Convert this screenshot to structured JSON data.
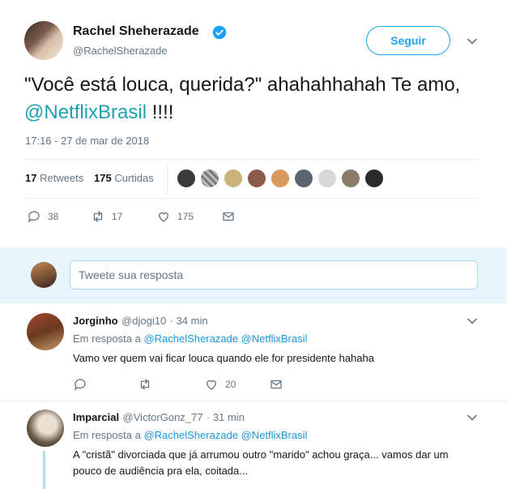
{
  "tweet": {
    "author_name": "Rachel Sheherazade",
    "author_handle": "@RachelSherazade",
    "follow_label": "Seguir",
    "text_before": "\"Você está louca, querida?\" ahahahhahah Te amo, ",
    "mention": "@NetflixBrasil",
    "text_after": " !!!!",
    "timestamp": "17:16 - 27 de mar de 2018",
    "retweets_count": "17",
    "retweets_label": "Retweets",
    "likes_count": "175",
    "likes_label": "Curtidas",
    "actions": {
      "replies": "38",
      "retweets": "17",
      "likes": "175"
    }
  },
  "reply_box": {
    "placeholder": "Tweete sua resposta"
  },
  "replies": [
    {
      "name": "Jorginho",
      "handle": "@djogi10",
      "time": "· 34 min",
      "in_reply_label": "Em resposta a",
      "in_reply_mentions": "@RachelSherazade @NetflixBrasil",
      "text": "Vamo ver quem vai ficar louca quando ele for presidente hahaha",
      "likes": "20"
    },
    {
      "name": "Imparcial",
      "handle": "@VictorGonz_77",
      "time": "· 31 min",
      "in_reply_label": "Em resposta a",
      "in_reply_mentions": "@RachelSherazade @NetflixBrasil",
      "text_line1": "A \"cristã\" divorciada que já arrumou outro \"marido\" achou graça... vamos dar um",
      "text_line2": "pouco de audiência pra ela, coitada..."
    }
  ],
  "colors": {
    "accent": "#1da1f2",
    "link": "#1b95e0",
    "reply_bg": "#e8f5fd",
    "divider": "#e6ecf0"
  },
  "icons": [
    "verified-icon",
    "chevron-down-icon",
    "reply-icon",
    "retweet-icon",
    "heart-icon",
    "message-icon"
  ]
}
